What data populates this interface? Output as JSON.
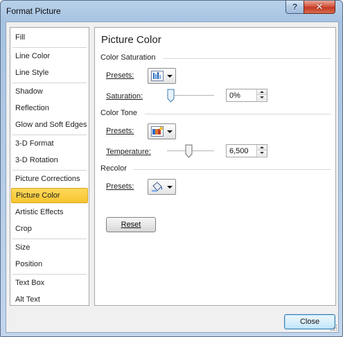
{
  "window": {
    "title": "Format Picture",
    "help_glyph": "?",
    "close_glyph": "✕"
  },
  "nav": {
    "groups": [
      [
        "Fill"
      ],
      [
        "Line Color",
        "Line Style"
      ],
      [
        "Shadow",
        "Reflection",
        "Glow and Soft Edges"
      ],
      [
        "3-D Format",
        "3-D Rotation"
      ],
      [
        "Picture Corrections",
        "Picture Color",
        "Artistic Effects",
        "Crop"
      ],
      [
        "Size",
        "Position"
      ],
      [
        "Text Box",
        "Alt Text"
      ]
    ],
    "items": [
      {
        "label": "Fill"
      },
      {
        "label": "Line Color"
      },
      {
        "label": "Line Style"
      },
      {
        "label": "Shadow"
      },
      {
        "label": "Reflection"
      },
      {
        "label": "Glow and Soft Edges"
      },
      {
        "label": "3-D Format"
      },
      {
        "label": "3-D Rotation"
      },
      {
        "label": "Picture Corrections"
      },
      {
        "label": "Picture Color",
        "selected": true
      },
      {
        "label": "Artistic Effects"
      },
      {
        "label": "Crop"
      },
      {
        "label": "Size"
      },
      {
        "label": "Position"
      },
      {
        "label": "Text Box"
      },
      {
        "label": "Alt Text"
      }
    ]
  },
  "panel": {
    "title": "Picture Color",
    "saturation": {
      "heading": "Color Saturation",
      "presets_label": "Presets:",
      "presets_icon": "saturation-presets-icon",
      "slider_label": "Saturation:",
      "slider_fraction": 0.0,
      "value": "0%"
    },
    "tone": {
      "heading": "Color Tone",
      "presets_label": "Presets:",
      "presets_icon": "color-tone-presets-icon",
      "slider_label": "Temperature:",
      "slider_fraction": 0.45,
      "value": "6,500"
    },
    "recolor": {
      "heading": "Recolor",
      "presets_label": "Presets:",
      "presets_icon": "recolor-presets-icon"
    },
    "reset_label": "Reset"
  },
  "footer": {
    "close_label": "Close"
  },
  "colors": {
    "selected_nav_bg": "#f7c531",
    "accent_blue": "#3c7fb1",
    "close_button_red": "#c23a23"
  }
}
